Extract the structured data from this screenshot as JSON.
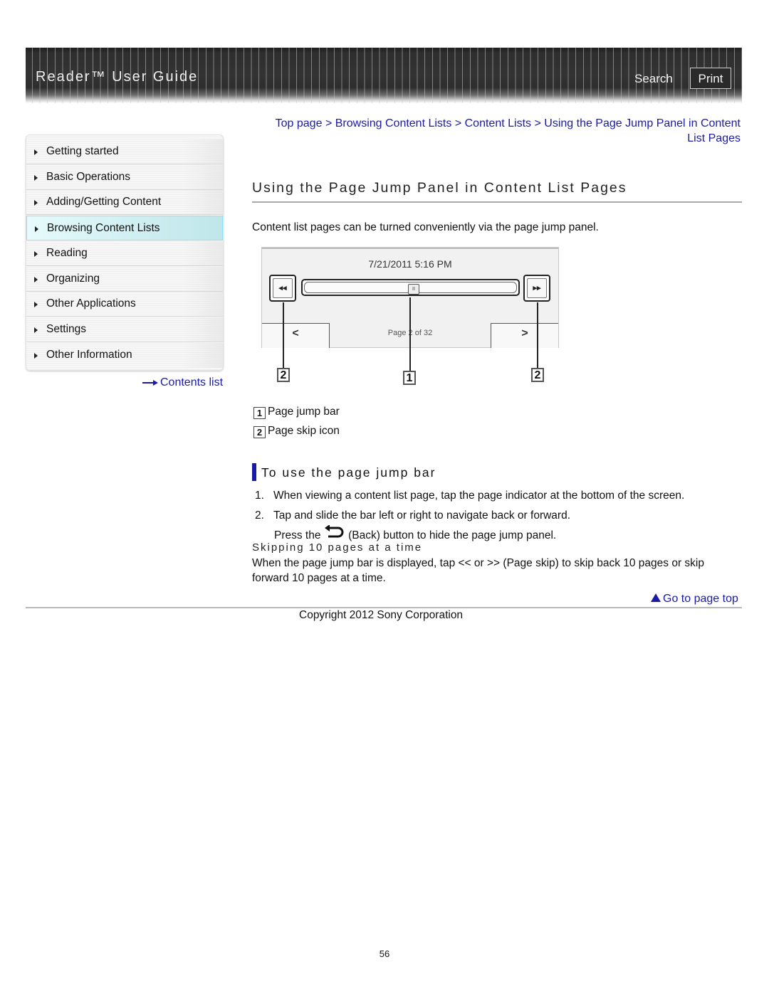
{
  "header": {
    "title": "Reader™ User Guide",
    "search_label": "Search",
    "print_label": "Print"
  },
  "sidebar": {
    "items": [
      {
        "label": "Getting started",
        "active": false
      },
      {
        "label": "Basic Operations",
        "active": false
      },
      {
        "label": "Adding/Getting Content",
        "active": false
      },
      {
        "label": "Browsing Content Lists",
        "active": true
      },
      {
        "label": "Reading",
        "active": false
      },
      {
        "label": "Organizing",
        "active": false
      },
      {
        "label": "Other Applications",
        "active": false
      },
      {
        "label": "Settings",
        "active": false
      },
      {
        "label": "Other Information",
        "active": false
      }
    ],
    "contents_link": "Contents list"
  },
  "breadcrumb": {
    "items": [
      "Top page",
      "Browsing Content Lists",
      "Content Lists",
      "Using the Page Jump Panel in Content List Pages"
    ],
    "separator": ">"
  },
  "main": {
    "title": "Using the Page Jump Panel in Content List Pages",
    "intro": "Content list pages can be turned conveniently via the page jump panel.",
    "figure": {
      "datetime": "7/21/2011 5:16 PM",
      "skip_back_glyph": "◂◂",
      "skip_forward_glyph": "▸▸",
      "thumb_glyph": "II",
      "prev_glyph": "<",
      "next_glyph": ">",
      "page_indicator": "Page 2 of 32",
      "callouts": [
        "2",
        "1",
        "2"
      ]
    },
    "legend": [
      {
        "num": "1",
        "label": "Page jump bar"
      },
      {
        "num": "2",
        "label": "Page skip icon"
      }
    ],
    "section": {
      "title": "To use the page jump bar",
      "steps": [
        {
          "num": "1.",
          "text": "When viewing a content list page, tap the page indicator at the bottom of the screen."
        },
        {
          "num": "2.",
          "text": "Tap and slide the bar left or right to navigate back or forward."
        }
      ],
      "note_before": "Press the",
      "note_after": "(Back) button to hide the page jump panel.",
      "subsection_title": "Skipping 10 pages at a time",
      "subsection_text": "When the page jump bar is displayed, tap << or >> (Page skip) to skip back 10 pages or skip forward 10 pages at a time."
    },
    "go_to_top": "Go to page top"
  },
  "footer": {
    "copyright": "Copyright 2012 Sony Corporation",
    "page_number": "56"
  },
  "colors": {
    "link": "#1a1aa6",
    "active_nav": "#d2f0f3",
    "header_bg": "#333333"
  }
}
